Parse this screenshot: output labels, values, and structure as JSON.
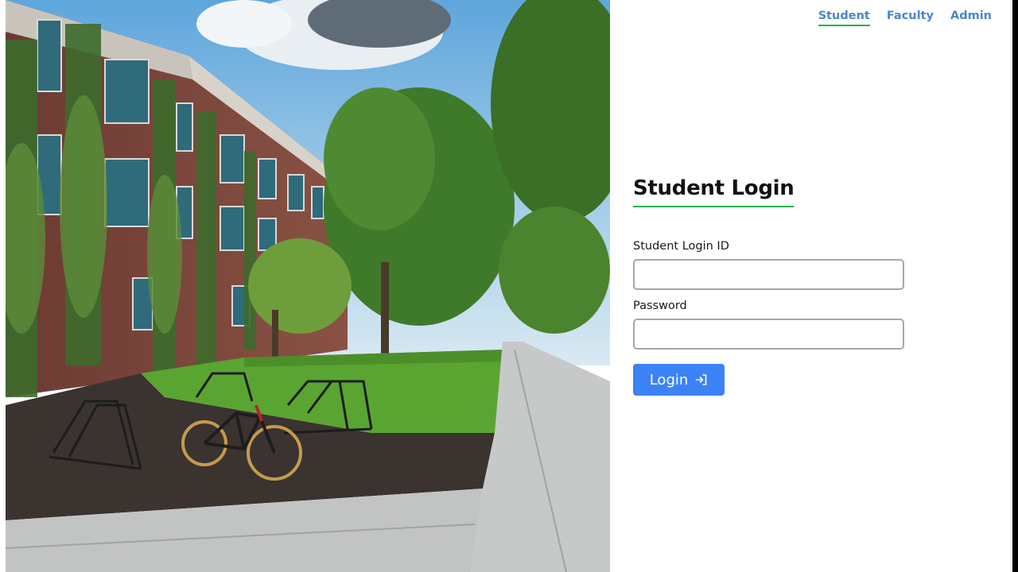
{
  "nav": {
    "items": [
      {
        "label": "Student",
        "active": true
      },
      {
        "label": "Faculty",
        "active": false
      },
      {
        "label": "Admin",
        "active": false
      }
    ]
  },
  "login": {
    "title": "Student Login",
    "id_label": "Student Login ID",
    "id_value": "",
    "password_label": "Password",
    "password_value": "",
    "button_label": "Login",
    "button_icon": "login-arrow-icon"
  },
  "colors": {
    "accent_underline": "#22b34a",
    "nav_link": "#4a86c8",
    "button": "#3b82f6"
  },
  "hero_image": {
    "subject": "campus-building-photo"
  }
}
